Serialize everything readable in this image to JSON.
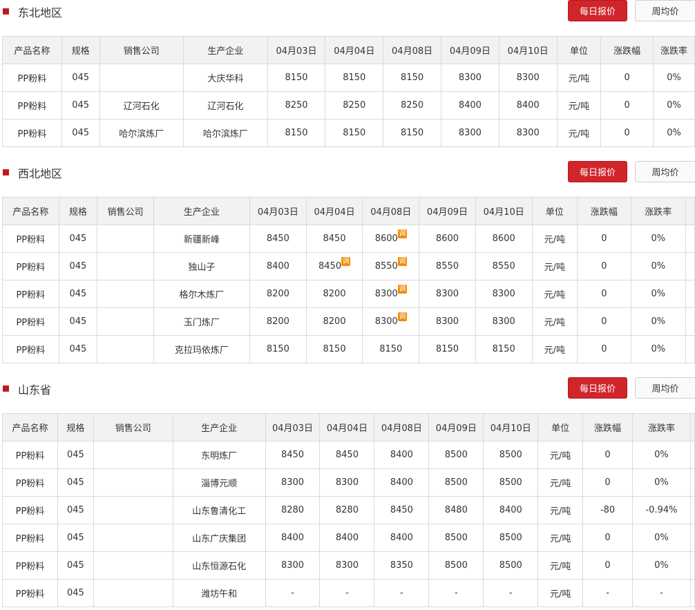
{
  "sections": [
    {
      "title": "东北地区",
      "daily_label": "每日报价",
      "weekly_label": "周均价",
      "headers": [
        "产品名称",
        "规格",
        "销售公司",
        "生产企业",
        "04月03日",
        "04月04日",
        "04月08日",
        "04月09日",
        "04月10日",
        "单位",
        "涨跌幅",
        "涨跌率"
      ],
      "rows": [
        {
          "product": "PP粉料",
          "spec": "045",
          "seller": "",
          "producer": "大庆华科",
          "prices": [
            "8150",
            "8150",
            "8150",
            "8300",
            "8300"
          ],
          "price_colors": [
            "red",
            "",
            "",
            "red",
            ""
          ],
          "adjusted": [
            false,
            false,
            false,
            false,
            false
          ],
          "unit": "元/吨",
          "change": "0",
          "change_color": "",
          "rate": "0%",
          "rate_color": ""
        },
        {
          "product": "PP粉料",
          "spec": "045",
          "seller": "辽河石化",
          "producer": "辽河石化",
          "prices": [
            "8250",
            "8250",
            "8250",
            "8400",
            "8400"
          ],
          "price_colors": [
            "red",
            "",
            "",
            "red",
            ""
          ],
          "adjusted": [
            false,
            false,
            false,
            false,
            false
          ],
          "unit": "元/吨",
          "change": "0",
          "change_color": "",
          "rate": "0%",
          "rate_color": ""
        },
        {
          "product": "PP粉料",
          "spec": "045",
          "seller": "哈尔滨炼厂",
          "producer": "哈尔滨炼厂",
          "prices": [
            "8150",
            "8150",
            "8150",
            "8300",
            "8300"
          ],
          "price_colors": [
            "red",
            "",
            "",
            "red",
            ""
          ],
          "adjusted": [
            false,
            false,
            false,
            false,
            false
          ],
          "unit": "元/吨",
          "change": "0",
          "change_color": "",
          "rate": "0%",
          "rate_color": ""
        }
      ]
    },
    {
      "title": "西北地区",
      "daily_label": "每日报价",
      "weekly_label": "周均价",
      "headers": [
        "产品名称",
        "规格",
        "销售公司",
        "生产企业",
        "04月03日",
        "04月04日",
        "04月08日",
        "04月09日",
        "04月10日",
        "单位",
        "涨跌幅",
        "涨跌率"
      ],
      "rows": [
        {
          "product": "PP粉料",
          "spec": "045",
          "seller": "",
          "producer": "新疆新峰",
          "prices": [
            "8450",
            "8450",
            "8600",
            "8600",
            "8600"
          ],
          "price_colors": [
            "",
            "",
            "",
            "",
            ""
          ],
          "adjusted": [
            false,
            false,
            true,
            false,
            false
          ],
          "unit": "元/吨",
          "change": "0",
          "change_color": "",
          "rate": "0%",
          "rate_color": ""
        },
        {
          "product": "PP粉料",
          "spec": "045",
          "seller": "",
          "producer": "独山子",
          "prices": [
            "8400",
            "8450",
            "8550",
            "8550",
            "8550"
          ],
          "price_colors": [
            "",
            "",
            "",
            "",
            ""
          ],
          "adjusted": [
            false,
            true,
            true,
            false,
            false
          ],
          "unit": "元/吨",
          "change": "0",
          "change_color": "",
          "rate": "0%",
          "rate_color": ""
        },
        {
          "product": "PP粉料",
          "spec": "045",
          "seller": "",
          "producer": "格尔木炼厂",
          "prices": [
            "8200",
            "8200",
            "8300",
            "8300",
            "8300"
          ],
          "price_colors": [
            "",
            "",
            "",
            "",
            ""
          ],
          "adjusted": [
            false,
            false,
            true,
            false,
            false
          ],
          "unit": "元/吨",
          "change": "0",
          "change_color": "",
          "rate": "0%",
          "rate_color": ""
        },
        {
          "product": "PP粉料",
          "spec": "045",
          "seller": "",
          "producer": "玉门炼厂",
          "prices": [
            "8200",
            "8200",
            "8300",
            "8300",
            "8300"
          ],
          "price_colors": [
            "",
            "",
            "",
            "",
            ""
          ],
          "adjusted": [
            false,
            false,
            true,
            false,
            false
          ],
          "unit": "元/吨",
          "change": "0",
          "change_color": "",
          "rate": "0%",
          "rate_color": ""
        },
        {
          "product": "PP粉料",
          "spec": "045",
          "seller": "",
          "producer": "克拉玛依炼厂",
          "prices": [
            "8150",
            "8150",
            "8150",
            "8150",
            "8150"
          ],
          "price_colors": [
            "",
            "",
            "",
            "",
            ""
          ],
          "adjusted": [
            false,
            false,
            false,
            false,
            false
          ],
          "unit": "元/吨",
          "change": "0",
          "change_color": "",
          "rate": "0%",
          "rate_color": ""
        }
      ]
    },
    {
      "title": "山东省",
      "daily_label": "每日报价",
      "weekly_label": "周均价",
      "headers": [
        "产品名称",
        "规格",
        "销售公司",
        "生产企业",
        "04月03日",
        "04月04日",
        "04月08日",
        "04月09日",
        "04月10日",
        "单位",
        "涨跌幅",
        "涨跌率"
      ],
      "rows": [
        {
          "product": "PP粉料",
          "spec": "045",
          "seller": "",
          "producer": "东明炼厂",
          "prices": [
            "8450",
            "8450",
            "8400",
            "8500",
            "8500"
          ],
          "price_colors": [
            "red",
            "",
            "green",
            "red",
            ""
          ],
          "adjusted": [
            false,
            false,
            false,
            false,
            false
          ],
          "unit": "元/吨",
          "change": "0",
          "change_color": "",
          "rate": "0%",
          "rate_color": ""
        },
        {
          "product": "PP粉料",
          "spec": "045",
          "seller": "",
          "producer": "淄博元顺",
          "prices": [
            "8300",
            "8300",
            "8400",
            "8500",
            "8500"
          ],
          "price_colors": [
            "",
            "",
            "red",
            "red",
            ""
          ],
          "adjusted": [
            false,
            false,
            false,
            false,
            false
          ],
          "unit": "元/吨",
          "change": "0",
          "change_color": "",
          "rate": "0%",
          "rate_color": ""
        },
        {
          "product": "PP粉料",
          "spec": "045",
          "seller": "",
          "producer": "山东鲁清化工",
          "prices": [
            "8280",
            "8280",
            "8450",
            "8480",
            "8400"
          ],
          "price_colors": [
            "red",
            "",
            "red",
            "red",
            "green"
          ],
          "adjusted": [
            false,
            false,
            false,
            false,
            false
          ],
          "unit": "元/吨",
          "change": "-80",
          "change_color": "green",
          "rate": "-0.94%",
          "rate_color": "green"
        },
        {
          "product": "PP粉料",
          "spec": "045",
          "seller": "",
          "producer": "山东广庆集团",
          "prices": [
            "8400",
            "8400",
            "8400",
            "8500",
            "8500"
          ],
          "price_colors": [
            "red",
            "",
            "",
            "red",
            ""
          ],
          "adjusted": [
            false,
            false,
            false,
            false,
            false
          ],
          "unit": "元/吨",
          "change": "0",
          "change_color": "",
          "rate": "0%",
          "rate_color": ""
        },
        {
          "product": "PP粉料",
          "spec": "045",
          "seller": "",
          "producer": "山东恒源石化",
          "prices": [
            "8300",
            "8300",
            "8350",
            "8500",
            "8500"
          ],
          "price_colors": [
            "",
            "",
            "red",
            "red",
            ""
          ],
          "adjusted": [
            false,
            false,
            false,
            false,
            false
          ],
          "unit": "元/吨",
          "change": "0",
          "change_color": "",
          "rate": "0%",
          "rate_color": ""
        },
        {
          "product": "PP粉料",
          "spec": "045",
          "seller": "",
          "producer": "潍坊午和",
          "prices": [
            "-",
            "-",
            "-",
            "-",
            "-"
          ],
          "price_colors": [
            "",
            "",
            "",
            "",
            ""
          ],
          "adjusted": [
            false,
            false,
            false,
            false,
            false
          ],
          "unit": "元/吨",
          "change": "-",
          "change_color": "",
          "rate": "-",
          "rate_color": ""
        }
      ]
    }
  ],
  "adjust_badge": "调",
  "colors": {
    "accent": "#d0252b",
    "up": "#e0262d",
    "down": "#3cb033",
    "link": "#1a56c8"
  }
}
